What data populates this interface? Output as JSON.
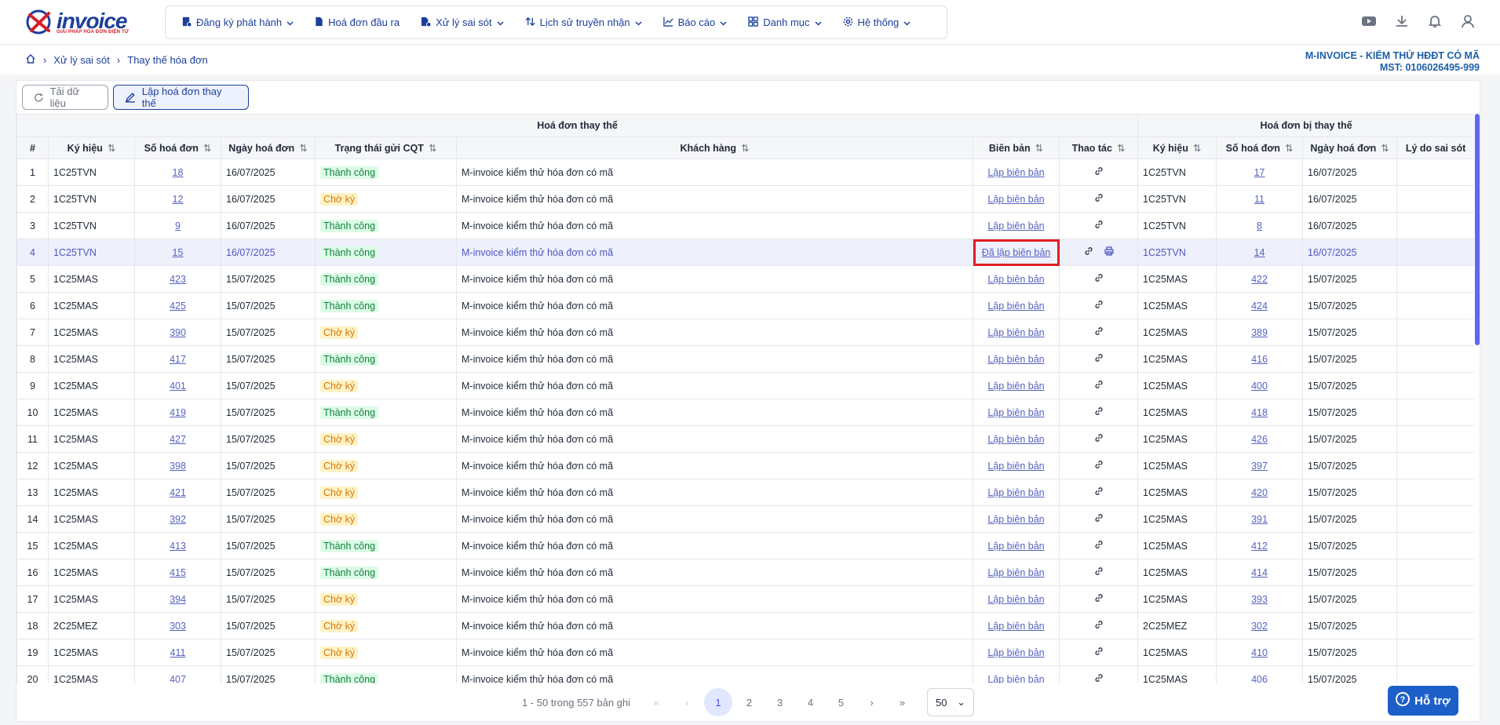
{
  "logo": {
    "brand": "invoice",
    "tagline": "GIẢI PHÁP HÓA ĐƠN ĐIỆN TỬ"
  },
  "menu": [
    {
      "label": "Đăng ký phát hành",
      "icon": "register-icon",
      "dropdown": true
    },
    {
      "label": "Hoá đơn đầu ra",
      "icon": "invoice-icon",
      "dropdown": false
    },
    {
      "label": "Xử lý sai sót",
      "icon": "fix-icon",
      "dropdown": true
    },
    {
      "label": "Lịch sử truyền nhận",
      "icon": "history-icon",
      "dropdown": true
    },
    {
      "label": "Báo cáo",
      "icon": "report-icon",
      "dropdown": true
    },
    {
      "label": "Danh mục",
      "icon": "catalog-icon",
      "dropdown": true
    },
    {
      "label": "Hệ thống",
      "icon": "settings-icon",
      "dropdown": true
    }
  ],
  "breadcrumb": [
    "Xử lý sai sót",
    "Thay thế hóa đơn"
  ],
  "company": {
    "name": "M-INVOICE - KIỂM THỬ HĐĐT CÓ MÃ",
    "mst": "MST: 0106026495-999"
  },
  "toolbar": {
    "reload": "Tải dữ liệu",
    "create": "Lập hoá đơn thay thế"
  },
  "table": {
    "group_left": "Hoá đơn thay thế",
    "group_right": "Hoá đơn bị thay thế",
    "columns": [
      "#",
      "Ký hiệu",
      "Số hoá đơn",
      "Ngày hoá đơn",
      "Trạng thái gửi CQT",
      "Khách hàng",
      "Biên bản",
      "Thao tác",
      "Ký hiệu",
      "Số hoá đơn",
      "Ngày hoá đơn",
      "Lý do sai sót"
    ],
    "rows": [
      {
        "n": "1",
        "kh": "1C25TVN",
        "so": "18",
        "ngay": "16/07/2025",
        "tt": "Thành công",
        "ok": true,
        "cust": "M-invoice kiểm thử hóa đơn có mã",
        "bb": "Lập biên bản",
        "kh2": "1C25TVN",
        "so2": "17",
        "ngay2": "16/07/2025"
      },
      {
        "n": "2",
        "kh": "1C25TVN",
        "so": "12",
        "ngay": "16/07/2025",
        "tt": "Chờ ký",
        "ok": false,
        "cust": "M-invoice kiểm thử hóa đơn có mã",
        "bb": "Lập biên bản",
        "kh2": "1C25TVN",
        "so2": "11",
        "ngay2": "16/07/2025"
      },
      {
        "n": "3",
        "kh": "1C25TVN",
        "so": "9",
        "ngay": "16/07/2025",
        "tt": "Thành công",
        "ok": true,
        "cust": "M-invoice kiểm thử hóa đơn có mã",
        "bb": "Lập biên bản",
        "kh2": "1C25TVN",
        "so2": "8",
        "ngay2": "16/07/2025"
      },
      {
        "n": "4",
        "kh": "1C25TVN",
        "so": "15",
        "ngay": "16/07/2025",
        "tt": "Thành công",
        "ok": true,
        "cust": "M-invoice kiểm thử hóa đơn có mã",
        "bb": "Đã lập biên bản",
        "kh2": "1C25TVN",
        "so2": "14",
        "ngay2": "16/07/2025",
        "hl": true
      },
      {
        "n": "5",
        "kh": "1C25MAS",
        "so": "423",
        "ngay": "15/07/2025",
        "tt": "Thành công",
        "ok": true,
        "cust": "M-invoice kiểm thử hóa đơn có mã",
        "bb": "Lập biên bản",
        "kh2": "1C25MAS",
        "so2": "422",
        "ngay2": "15/07/2025"
      },
      {
        "n": "6",
        "kh": "1C25MAS",
        "so": "425",
        "ngay": "15/07/2025",
        "tt": "Thành công",
        "ok": true,
        "cust": "M-invoice kiểm thử hóa đơn có mã",
        "bb": "Lập biên bản",
        "kh2": "1C25MAS",
        "so2": "424",
        "ngay2": "15/07/2025"
      },
      {
        "n": "7",
        "kh": "1C25MAS",
        "so": "390",
        "ngay": "15/07/2025",
        "tt": "Chờ ký",
        "ok": false,
        "cust": "M-invoice kiểm thử hóa đơn có mã",
        "bb": "Lập biên bản",
        "kh2": "1C25MAS",
        "so2": "389",
        "ngay2": "15/07/2025"
      },
      {
        "n": "8",
        "kh": "1C25MAS",
        "so": "417",
        "ngay": "15/07/2025",
        "tt": "Thành công",
        "ok": true,
        "cust": "M-invoice kiểm thử hóa đơn có mã",
        "bb": "Lập biên bản",
        "kh2": "1C25MAS",
        "so2": "416",
        "ngay2": "15/07/2025"
      },
      {
        "n": "9",
        "kh": "1C25MAS",
        "so": "401",
        "ngay": "15/07/2025",
        "tt": "Chờ ký",
        "ok": false,
        "cust": "M-invoice kiểm thử hóa đơn có mã",
        "bb": "Lập biên bản",
        "kh2": "1C25MAS",
        "so2": "400",
        "ngay2": "15/07/2025"
      },
      {
        "n": "10",
        "kh": "1C25MAS",
        "so": "419",
        "ngay": "15/07/2025",
        "tt": "Thành công",
        "ok": true,
        "cust": "M-invoice kiểm thử hóa đơn có mã",
        "bb": "Lập biên bản",
        "kh2": "1C25MAS",
        "so2": "418",
        "ngay2": "15/07/2025"
      },
      {
        "n": "11",
        "kh": "1C25MAS",
        "so": "427",
        "ngay": "15/07/2025",
        "tt": "Chờ ký",
        "ok": false,
        "cust": "M-invoice kiểm thử hóa đơn có mã",
        "bb": "Lập biên bản",
        "kh2": "1C25MAS",
        "so2": "426",
        "ngay2": "15/07/2025"
      },
      {
        "n": "12",
        "kh": "1C25MAS",
        "so": "398",
        "ngay": "15/07/2025",
        "tt": "Chờ ký",
        "ok": false,
        "cust": "M-invoice kiểm thử hóa đơn có mã",
        "bb": "Lập biên bản",
        "kh2": "1C25MAS",
        "so2": "397",
        "ngay2": "15/07/2025"
      },
      {
        "n": "13",
        "kh": "1C25MAS",
        "so": "421",
        "ngay": "15/07/2025",
        "tt": "Chờ ký",
        "ok": false,
        "cust": "M-invoice kiểm thử hóa đơn có mã",
        "bb": "Lập biên bản",
        "kh2": "1C25MAS",
        "so2": "420",
        "ngay2": "15/07/2025"
      },
      {
        "n": "14",
        "kh": "1C25MAS",
        "so": "392",
        "ngay": "15/07/2025",
        "tt": "Chờ ký",
        "ok": false,
        "cust": "M-invoice kiểm thử hóa đơn có mã",
        "bb": "Lập biên bản",
        "kh2": "1C25MAS",
        "so2": "391",
        "ngay2": "15/07/2025"
      },
      {
        "n": "15",
        "kh": "1C25MAS",
        "so": "413",
        "ngay": "15/07/2025",
        "tt": "Thành công",
        "ok": true,
        "cust": "M-invoice kiểm thử hóa đơn có mã",
        "bb": "Lập biên bản",
        "kh2": "1C25MAS",
        "so2": "412",
        "ngay2": "15/07/2025"
      },
      {
        "n": "16",
        "kh": "1C25MAS",
        "so": "415",
        "ngay": "15/07/2025",
        "tt": "Thành công",
        "ok": true,
        "cust": "M-invoice kiểm thử hóa đơn có mã",
        "bb": "Lập biên bản",
        "kh2": "1C25MAS",
        "so2": "414",
        "ngay2": "15/07/2025"
      },
      {
        "n": "17",
        "kh": "1C25MAS",
        "so": "394",
        "ngay": "15/07/2025",
        "tt": "Chờ ký",
        "ok": false,
        "cust": "M-invoice kiểm thử hóa đơn có mã",
        "bb": "Lập biên bản",
        "kh2": "1C25MAS",
        "so2": "393",
        "ngay2": "15/07/2025"
      },
      {
        "n": "18",
        "kh": "2C25MEZ",
        "so": "303",
        "ngay": "15/07/2025",
        "tt": "Chờ ký",
        "ok": false,
        "cust": "M-invoice kiểm thử hóa đơn có mã",
        "bb": "Lập biên bản",
        "kh2": "2C25MEZ",
        "so2": "302",
        "ngay2": "15/07/2025"
      },
      {
        "n": "19",
        "kh": "1C25MAS",
        "so": "411",
        "ngay": "15/07/2025",
        "tt": "Chờ ký",
        "ok": false,
        "cust": "M-invoice kiểm thử hóa đơn có mã",
        "bb": "Lập biên bản",
        "kh2": "1C25MAS",
        "so2": "410",
        "ngay2": "15/07/2025"
      },
      {
        "n": "20",
        "kh": "1C25MAS",
        "so": "407",
        "ngay": "15/07/2025",
        "tt": "Thành công",
        "ok": true,
        "cust": "M-invoice kiểm thử hóa đơn có mã",
        "bb": "Lập biên bản",
        "kh2": "1C25MAS",
        "so2": "406",
        "ngay2": "15/07/2025"
      }
    ]
  },
  "pagination": {
    "info": "1 - 50 trong 557 bản ghi",
    "pages": [
      "1",
      "2",
      "3",
      "4",
      "5"
    ],
    "current": "1",
    "page_size": "50"
  },
  "support": "Hỗ trợ",
  "colors": {
    "brand": "#1d3f9b",
    "link": "#5563c1",
    "success": "#15803d",
    "pending": "#d97706",
    "highlight": "#e11d24"
  }
}
